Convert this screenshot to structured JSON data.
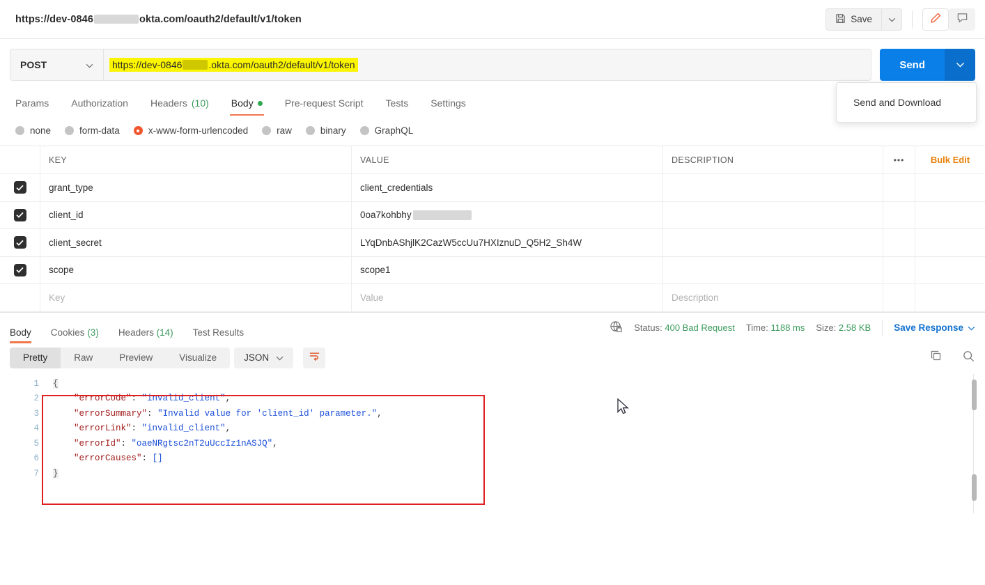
{
  "titlebar": {
    "request_title_prefix": "https://dev-0846",
    "request_title_suffix": "okta.com/oauth2/default/v1/token",
    "save_label": "Save",
    "save_icon": "floppy-disk-icon",
    "save_caret_icon": "chevron-down-icon",
    "edit_icon": "pencil-icon",
    "comment_icon": "comment-icon"
  },
  "urlbar": {
    "method": "POST",
    "method_caret_icon": "chevron-down-icon",
    "url_prefix": "https://dev-0846",
    "url_suffix": ".okta.com/oauth2/default/v1/token",
    "send_label": "Send",
    "send_caret_icon": "chevron-down-icon",
    "highlight_color": "#fbf500",
    "send_color": "#0b7fe8"
  },
  "send_dropdown": {
    "item_label": "Send and Download"
  },
  "request_tabs": [
    {
      "label": "Params",
      "count": "",
      "active": false,
      "dot": false
    },
    {
      "label": "Authorization",
      "count": "",
      "active": false,
      "dot": false
    },
    {
      "label": "Headers",
      "count": "(10)",
      "active": false,
      "dot": false
    },
    {
      "label": "Body",
      "count": "",
      "active": true,
      "dot": true
    },
    {
      "label": "Pre-request Script",
      "count": "",
      "active": false,
      "dot": false
    },
    {
      "label": "Tests",
      "count": "",
      "active": false,
      "dot": false
    },
    {
      "label": "Settings",
      "count": "",
      "active": false,
      "dot": false
    }
  ],
  "body_types": [
    {
      "label": "none",
      "selected": false
    },
    {
      "label": "form-data",
      "selected": false
    },
    {
      "label": "x-www-form-urlencoded",
      "selected": true
    },
    {
      "label": "raw",
      "selected": false
    },
    {
      "label": "binary",
      "selected": false
    },
    {
      "label": "GraphQL",
      "selected": false
    }
  ],
  "kv_table": {
    "headers": {
      "key": "KEY",
      "value": "VALUE",
      "description": "DESCRIPTION"
    },
    "more_icon": "ellipsis-icon",
    "bulk_edit_label": "Bulk Edit",
    "rows": [
      {
        "checked": true,
        "key": "grant_type",
        "value": "client_credentials",
        "description": "",
        "value_redacted": false
      },
      {
        "checked": true,
        "key": "client_id",
        "value": "0oa7kohbhy",
        "description": "",
        "value_redacted": true
      },
      {
        "checked": true,
        "key": "client_secret",
        "value": "LYqDnbAShjlK2CazW5ccUu7HXIznuD_Q5H2_Sh4W",
        "description": "",
        "value_redacted": false
      },
      {
        "checked": true,
        "key": "scope",
        "value": "scope1",
        "description": "",
        "value_redacted": false
      }
    ],
    "placeholder_row": {
      "key": "Key",
      "value": "Value",
      "description": "Description"
    }
  },
  "response": {
    "tabs": [
      {
        "label": "Body",
        "count": "",
        "active": true
      },
      {
        "label": "Cookies",
        "count": "(3)",
        "active": false
      },
      {
        "label": "Headers",
        "count": "(14)",
        "active": false
      },
      {
        "label": "Test Results",
        "count": "",
        "active": false
      }
    ],
    "lock_icon": "globe-lock-icon",
    "status_label": "Status:",
    "status_value": "400 Bad Request",
    "time_label": "Time:",
    "time_value": "1188 ms",
    "size_label": "Size:",
    "size_value": "2.58 KB",
    "save_response_label": "Save Response",
    "save_response_caret_icon": "chevron-down-icon",
    "format_tabs": [
      {
        "label": "Pretty",
        "active": true
      },
      {
        "label": "Raw",
        "active": false
      },
      {
        "label": "Preview",
        "active": false
      },
      {
        "label": "Visualize",
        "active": false
      }
    ],
    "language": "JSON",
    "language_caret_icon": "chevron-down-icon",
    "wrap_icon": "word-wrap-icon",
    "copy_icon": "copy-icon",
    "search_icon": "search-icon",
    "line_numbers": [
      "1",
      "2",
      "3",
      "4",
      "5",
      "6",
      "7"
    ],
    "highlight_box_color": "#e02020",
    "json_lines": [
      {
        "indent": 0,
        "parts": [
          {
            "t": "{",
            "c": "brace"
          }
        ]
      },
      {
        "indent": 1,
        "parts": [
          {
            "t": "\"errorCode\"",
            "c": "k"
          },
          {
            "t": ": ",
            "c": "p"
          },
          {
            "t": "\"invalid_client\"",
            "c": "s"
          },
          {
            "t": ",",
            "c": "p"
          }
        ]
      },
      {
        "indent": 1,
        "parts": [
          {
            "t": "\"errorSummary\"",
            "c": "k"
          },
          {
            "t": ": ",
            "c": "p"
          },
          {
            "t": "\"Invalid value for 'client_id' parameter.\"",
            "c": "s"
          },
          {
            "t": ",",
            "c": "p"
          }
        ]
      },
      {
        "indent": 1,
        "parts": [
          {
            "t": "\"errorLink\"",
            "c": "k"
          },
          {
            "t": ": ",
            "c": "p"
          },
          {
            "t": "\"invalid_client\"",
            "c": "s"
          },
          {
            "t": ",",
            "c": "p"
          }
        ]
      },
      {
        "indent": 1,
        "parts": [
          {
            "t": "\"errorId\"",
            "c": "k"
          },
          {
            "t": ": ",
            "c": "p"
          },
          {
            "t": "\"oaeNRgtsc2nT2uUccIz1nASJQ\"",
            "c": "s"
          },
          {
            "t": ",",
            "c": "p"
          }
        ]
      },
      {
        "indent": 1,
        "parts": [
          {
            "t": "\"errorCauses\"",
            "c": "k"
          },
          {
            "t": ": ",
            "c": "p"
          },
          {
            "t": "[]",
            "c": "s"
          }
        ]
      },
      {
        "indent": 0,
        "parts": [
          {
            "t": "}",
            "c": "brace"
          }
        ]
      }
    ]
  }
}
